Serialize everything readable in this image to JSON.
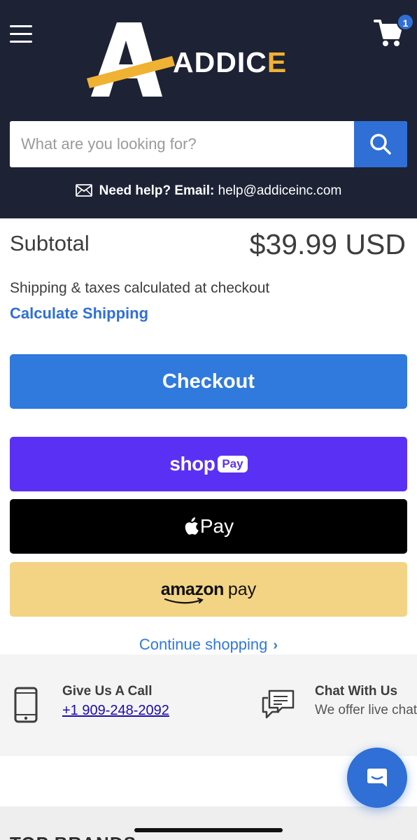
{
  "header": {
    "brand_name_main": "ADDIC",
    "brand_name_accent": "E",
    "cart_count": "1",
    "search": {
      "placeholder": "What are you looking for?"
    },
    "help": {
      "label": "Need help? Email:",
      "email": "help@addiceinc.com"
    }
  },
  "cart": {
    "subtotal_label": "Subtotal",
    "subtotal_value": "$39.99 USD",
    "shipping_note": "Shipping & taxes calculated at checkout",
    "calculate_shipping": "Calculate Shipping",
    "checkout_label": "Checkout",
    "shop_pay": {
      "shop": "shop",
      "pay": "Pay"
    },
    "apple_pay": {
      "label": "Pay"
    },
    "amazon_pay": {
      "amazon": "amazon",
      "pay": "pay"
    },
    "continue_shopping": "Continue shopping",
    "continue_chevron": "›"
  },
  "contact": {
    "call_title": "Give Us A Call",
    "call_phone": "+1 909-248-2092",
    "chat_title": "Chat With Us",
    "chat_sub": "We offer live chat"
  },
  "footer": {
    "peek_text": "TOP BRANDS"
  },
  "colors": {
    "header_bg": "#1d2235",
    "accent_blue": "#3079dd",
    "shop_pay_purple": "#5a31f4",
    "amazon_yellow": "#f2d484",
    "logo_gold": "#f0b233"
  },
  "icons": [
    "hamburger-icon",
    "cart-icon",
    "search-icon",
    "mail-icon",
    "phone-icon",
    "chat-bubbles-icon",
    "chat-fab-icon",
    "apple-logo-icon",
    "amazon-smile-icon"
  ]
}
